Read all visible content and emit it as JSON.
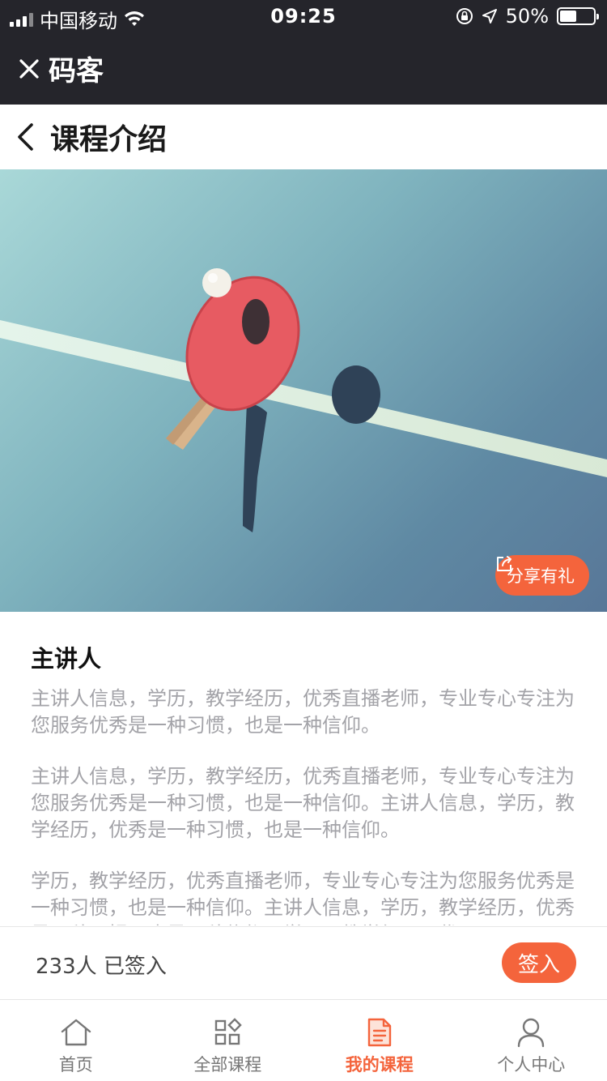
{
  "status_bar": {
    "carrier": "中国移动",
    "time": "09:25",
    "battery_text": "50%",
    "battery_level": 0.5
  },
  "app_bar": {
    "close_icon": "close-icon",
    "title": "码客"
  },
  "page_header": {
    "back_icon": "chevron-left-icon",
    "title": "课程介绍"
  },
  "hero": {
    "image": "ping-pong-paddle-photo",
    "share_icon": "share-icon",
    "share_label": "分享有礼"
  },
  "content": {
    "heading": "主讲人",
    "paragraphs": [
      "主讲人信息，学历，教学经历，优秀直播老师，专业专心专注为您服务优秀是一种习惯，也是一种信仰。",
      "主讲人信息，学历，教学经历，优秀直播老师，专业专心专注为您服务优秀是一种习惯，也是一种信仰。主讲人信息，学历，教学经历，优秀是一种习惯，也是一种信仰。",
      "学历，教学经历，优秀直播老师，专业专心专注为您服务优秀是一种习惯，也是一种信仰。主讲人信息，学历，教学经历，优秀是一种习惯，也是一种信仰。学历，教学经历，优"
    ]
  },
  "checkin": {
    "count_text": "233人 已签入",
    "button_label": "签入"
  },
  "tabs": [
    {
      "label": "首页",
      "icon": "home-icon",
      "active": false
    },
    {
      "label": "全部课程",
      "icon": "grid-icon",
      "active": false
    },
    {
      "label": "我的课程",
      "icon": "document-icon",
      "active": true
    },
    {
      "label": "个人中心",
      "icon": "person-icon",
      "active": false
    }
  ],
  "colors": {
    "accent": "#f4643c",
    "dark_bar": "#25252b",
    "muted_text": "#a3a3a8"
  }
}
